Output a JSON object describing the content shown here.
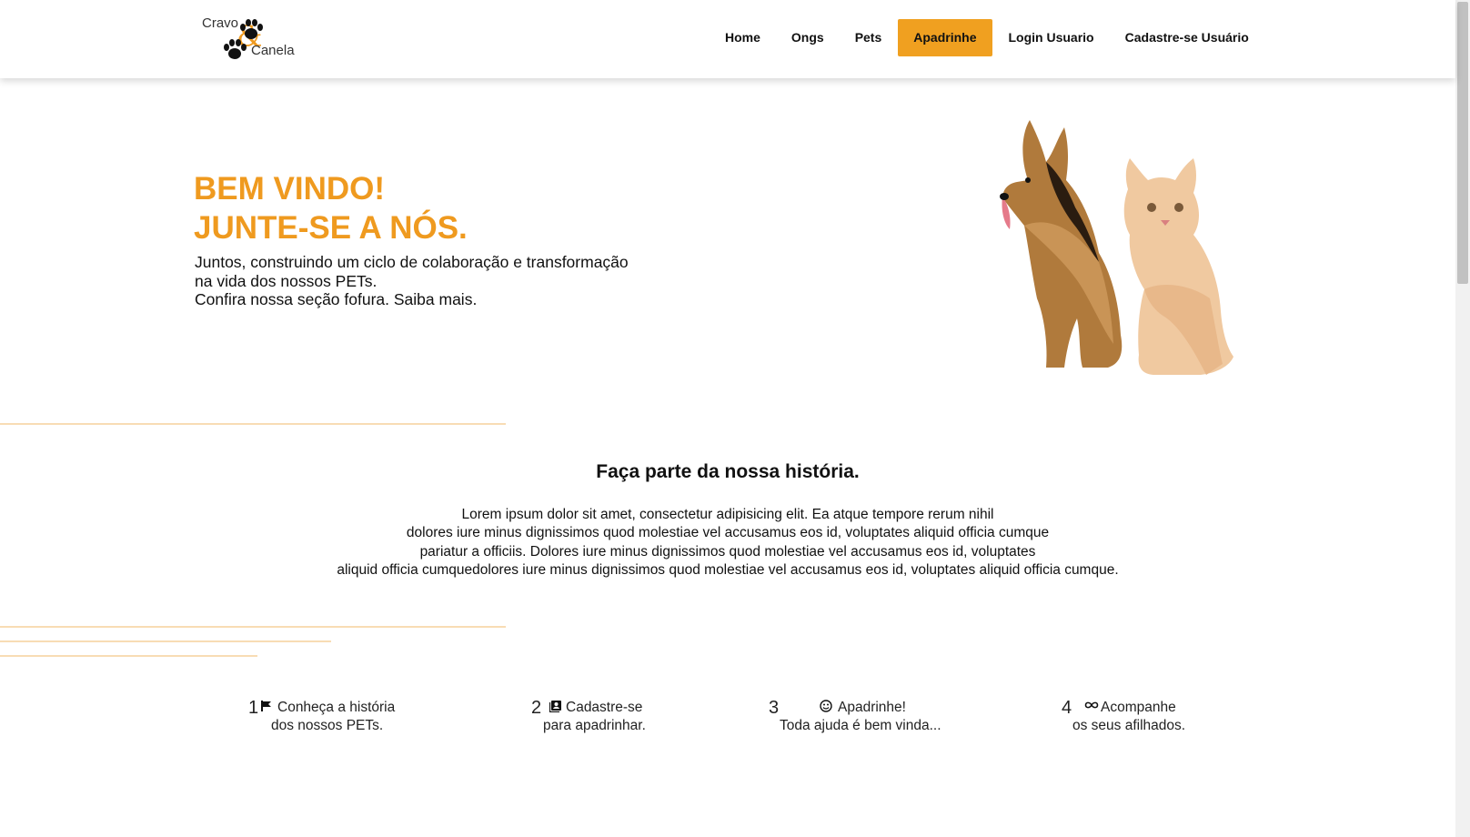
{
  "brand": {
    "line1": "Cravo",
    "amp": "&",
    "line2": "Canela"
  },
  "nav": {
    "home": "Home",
    "ongs": "Ongs",
    "pets": "Pets",
    "apadrinhe": "Apadrinhe",
    "login": "Login Usuario",
    "cadastro": "Cadastre-se Usuário"
  },
  "colors": {
    "accent": "#ef9a1f",
    "button": "#f0a020",
    "divider": "#f8dcb4"
  },
  "hero": {
    "title_line1": "BEM VINDO!",
    "title_line2": "JUNTE-SE A NÓS.",
    "text_line1": "Juntos, construindo um ciclo de colaboração e transformação",
    "text_line2": "na vida dos nossos PETs.",
    "text_line3": "Confira nossa seção fofura. Saiba mais."
  },
  "history": {
    "title": "Faça parte da nossa história.",
    "line1": "Lorem ipsum dolor sit amet, consectetur adipisicing elit. Ea atque tempore rerum nihil",
    "line2": "dolores iure minus dignissimos quod molestiae vel accusamus eos id, voluptates aliquid officia cumque",
    "line3": "pariatur a officiis. Dolores iure minus dignissimos quod molestiae vel accusamus eos id, voluptates",
    "line4": "aliquid officia cumquedolores iure minus dignissimos quod molestiae vel accusamus eos id, voluptates aliquid officia cumque."
  },
  "steps": [
    {
      "num": "1",
      "icon": "flag-icon",
      "line1": "Conheça a história",
      "line2": "dos nossos PETs."
    },
    {
      "num": "2",
      "icon": "contact-card-icon",
      "line1": "Cadastre-se",
      "line2": "para apadrinhar."
    },
    {
      "num": "3",
      "icon": "smiley-icon",
      "line1": "Apadrinhe!",
      "line2": "Toda ajuda é bem vinda..."
    },
    {
      "num": "4",
      "icon": "infinity-icon",
      "line1": "Acompanhe",
      "line2": "os seus afilhados."
    }
  ]
}
